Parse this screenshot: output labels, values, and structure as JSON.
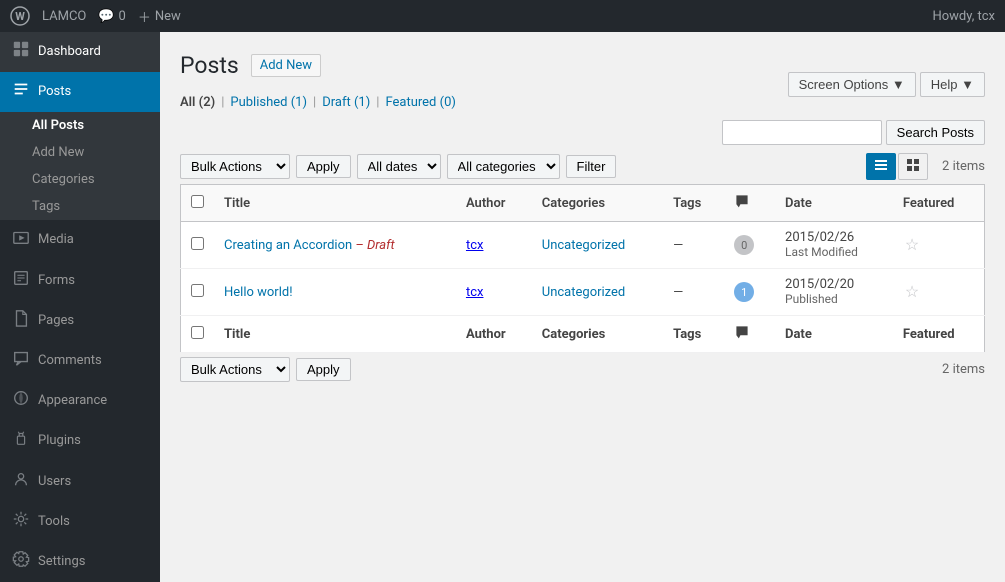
{
  "adminBar": {
    "siteName": "LAMCO",
    "commentCount": "0",
    "newLabel": "New",
    "howdy": "Howdy, tcx"
  },
  "screenOptions": {
    "label": "Screen Options",
    "arrow": "▼"
  },
  "help": {
    "label": "Help",
    "arrow": "▼"
  },
  "page": {
    "title": "Posts",
    "addNewLabel": "Add New"
  },
  "subNav": {
    "allLabel": "All",
    "allCount": "(2)",
    "publishedLabel": "Published",
    "publishedCount": "(1)",
    "draftLabel": "Draft",
    "draftCount": "(1)",
    "featuredLabel": "Featured",
    "featuredCount": "(0)"
  },
  "search": {
    "placeholder": "",
    "buttonLabel": "Search Posts"
  },
  "filters": {
    "bulkActionsLabel": "Bulk Actions",
    "applyLabel": "Apply",
    "allDatesLabel": "All dates",
    "allCategoriesLabel": "All categories",
    "filterLabel": "Filter"
  },
  "itemsCount": "2 items",
  "table": {
    "headers": {
      "title": "Title",
      "author": "Author",
      "categories": "Categories",
      "tags": "Tags",
      "date": "Date",
      "featured": "Featured"
    },
    "rows": [
      {
        "id": 1,
        "title": "Creating an Accordion",
        "titleSuffix": " – Draft",
        "author": "tcx",
        "categories": "Uncategorized",
        "tags": "—",
        "comments": "0",
        "date": "2015/02/26",
        "dateMeta": "Last Modified",
        "featured": false
      },
      {
        "id": 2,
        "title": "Hello world!",
        "titleSuffix": "",
        "author": "tcx",
        "categories": "Uncategorized",
        "tags": "—",
        "comments": "1",
        "date": "2015/02/20",
        "dateMeta": "Published",
        "featured": false
      }
    ]
  },
  "sidebar": {
    "items": [
      {
        "id": "dashboard",
        "label": "Dashboard",
        "icon": "dashboard"
      },
      {
        "id": "posts",
        "label": "Posts",
        "icon": "posts",
        "active": true
      },
      {
        "id": "media",
        "label": "Media",
        "icon": "media"
      },
      {
        "id": "forms",
        "label": "Forms",
        "icon": "forms"
      },
      {
        "id": "pages",
        "label": "Pages",
        "icon": "pages"
      },
      {
        "id": "comments",
        "label": "Comments",
        "icon": "comments"
      },
      {
        "id": "appearance",
        "label": "Appearance",
        "icon": "appearance"
      },
      {
        "id": "plugins",
        "label": "Plugins",
        "icon": "plugins"
      },
      {
        "id": "users",
        "label": "Users",
        "icon": "users"
      },
      {
        "id": "tools",
        "label": "Tools",
        "icon": "tools"
      },
      {
        "id": "settings",
        "label": "Settings",
        "icon": "settings"
      }
    ],
    "postsSubMenu": [
      {
        "id": "all-posts",
        "label": "All Posts",
        "active": true
      },
      {
        "id": "add-new",
        "label": "Add New"
      },
      {
        "id": "categories",
        "label": "Categories"
      },
      {
        "id": "tags",
        "label": "Tags"
      }
    ]
  }
}
